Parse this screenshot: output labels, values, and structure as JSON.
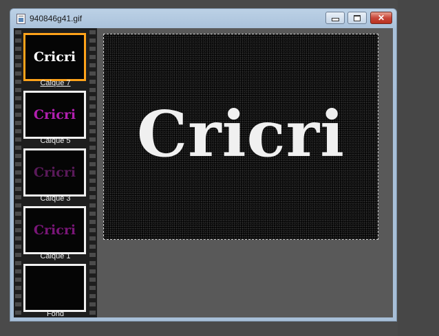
{
  "window": {
    "title": "940846g41.gif",
    "buttons": {
      "minimize": "minimize",
      "maximize": "maximize",
      "close": "✕"
    }
  },
  "frames": [
    {
      "label": "Calque 7",
      "text": "Cricri",
      "text_color": "#ffffff",
      "active": true
    },
    {
      "label": "Calque 5",
      "text": "Cricri",
      "text_color": "#b21fb0",
      "active": false
    },
    {
      "label": "Calque 3",
      "text": "Cricri",
      "text_color": "#5a1a5a",
      "active": false
    },
    {
      "label": "Calque 1",
      "text": "Cricri",
      "text_color": "#7a1678",
      "active": false
    },
    {
      "label": "Fond",
      "text": "",
      "text_color": "#000000",
      "active": false
    }
  ],
  "canvas": {
    "text": "Cricri",
    "text_color": "#f0f0f0",
    "background": "#060606"
  },
  "colors": {
    "selected_frame_border": "#ffa31a",
    "filmstrip": "#1e1e1e",
    "workspace": "#595959"
  }
}
